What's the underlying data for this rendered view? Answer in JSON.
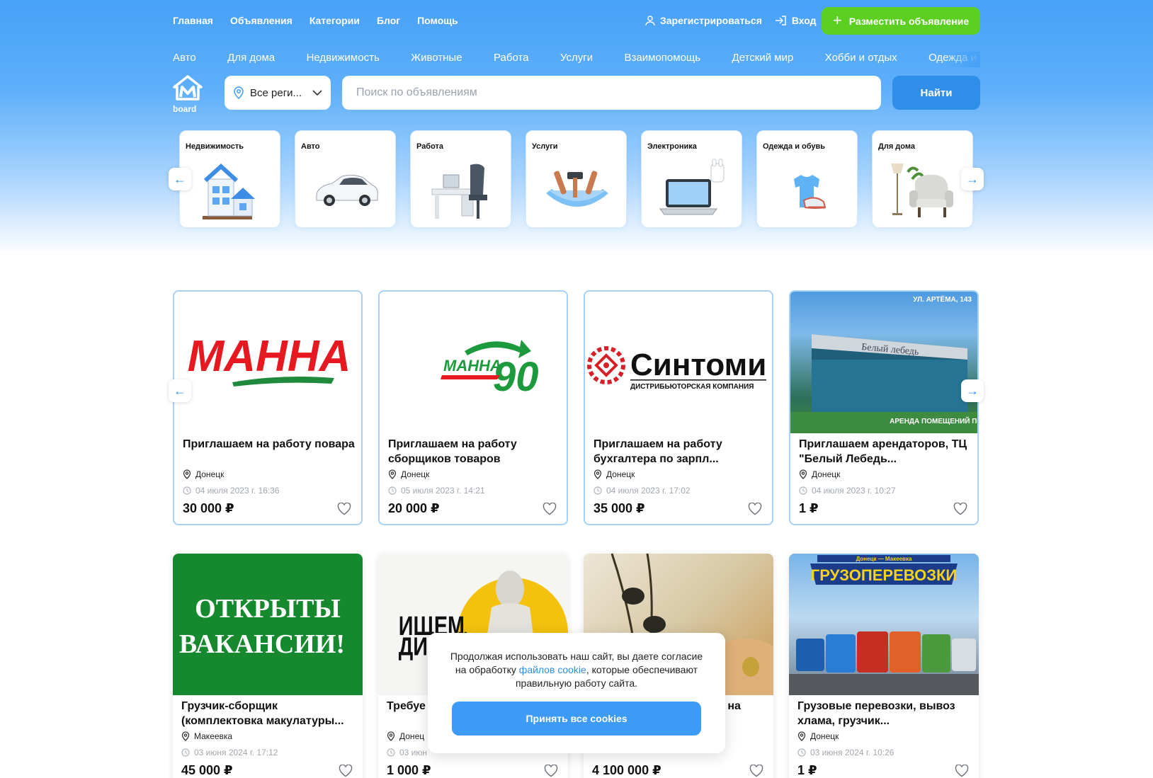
{
  "nav": {
    "links": [
      "Главная",
      "Объявления",
      "Категории",
      "Блог",
      "Помощь"
    ],
    "register": "Зарегистрироваться",
    "login": "Вход",
    "post_ad": "Разместить объявление"
  },
  "category_links": [
    "Авто",
    "Для дома",
    "Недвижимость",
    "Животные",
    "Работа",
    "Услуги",
    "Взаимопомощь",
    "Детский мир",
    "Хобби и отдых",
    "Одежда и обувь"
  ],
  "search": {
    "logo_text": "board",
    "region": "Все реги...",
    "placeholder": "Поиск по объявлениям",
    "button": "Найти"
  },
  "category_cards": [
    {
      "title": "Недвижимость",
      "icon": "house-icon"
    },
    {
      "title": "Авто",
      "icon": "car-icon"
    },
    {
      "title": "Работа",
      "icon": "office-desk-icon"
    },
    {
      "title": "Услуги",
      "icon": "tools-icon"
    },
    {
      "title": "Электроника",
      "icon": "laptop-icon"
    },
    {
      "title": "Одежда и обувь",
      "icon": "clothes-icon"
    },
    {
      "title": "Для дома",
      "icon": "armchair-icon"
    }
  ],
  "featured": [
    {
      "title": "Приглашаем на работу повара",
      "city": "Донецк",
      "date": "04 июля 2023 г. 16:36",
      "price": "30 000 ₽",
      "image_text": "МАННА"
    },
    {
      "title": "Приглашаем на работу сборщиков товаров",
      "city": "Донецк",
      "date": "05 июля 2023 г. 14:21",
      "price": "20 000 ₽",
      "image_text_1": "МАННА",
      "image_text_2": "90"
    },
    {
      "title": "Приглашаем на работу бухгалтера по зарпл...",
      "city": "Донецк",
      "date": "04 июля 2023 г. 17:02",
      "price": "35 000 ₽",
      "image_text_1": "Синтоми",
      "image_text_2": "ДИСТРИБЬЮТОРСКАЯ КОМПАНИЯ"
    },
    {
      "title": "Приглашаем арендаторов, ТЦ \"Белый Лебедь...",
      "city": "Донецк",
      "date": "04 июля 2023 г. 10:27",
      "price": "1 ₽",
      "image_text_1": "УЛ. АРТЁМА, 143",
      "image_text_2": "Белый лебедь",
      "image_text_3": "АРЕНДА ПОМЕЩЕНИЙ ПО НОМЕРУ:"
    }
  ],
  "listings": [
    {
      "title": "Грузчик-сборщик (комплектовка макулатуры...",
      "city": "Макеевка",
      "date": "03 июня 2024 г. 17:12",
      "price": "45 000 ₽",
      "image_text_1": "ОТКРЫТЫ",
      "image_text_2": "ВАКАНСИИ!"
    },
    {
      "title": "Требуе",
      "city": "Донец",
      "date": "03 июн",
      "price": "1 000 ₽",
      "image_text_1": "ИЩЕМ",
      "image_text_2": "ДИЗАЙНЕРА"
    },
    {
      "title": "у на",
      "city": "",
      "date": "",
      "price": "4 100 000 ₽"
    },
    {
      "title": "Грузовые перевозки, вывоз хлама, грузчик...",
      "city": "Донецк",
      "date": "03 июня 2024 г. 10:26",
      "price": "1 ₽",
      "image_text_1": "Донецк — Макеевка",
      "image_text_2": "ГРУЗОПЕРЕВОЗКИ"
    }
  ],
  "cookie": {
    "text_before": "Продолжая использовать наш сайт, вы даете согласие на обработку ",
    "link": "файлов cookie",
    "text_after": ", которые обеспечивают правильную работу сайта.",
    "accept": "Принять все cookies"
  },
  "colors": {
    "accent": "#2f8fe8",
    "green": "#5cd021",
    "header": "#47a1f7"
  }
}
